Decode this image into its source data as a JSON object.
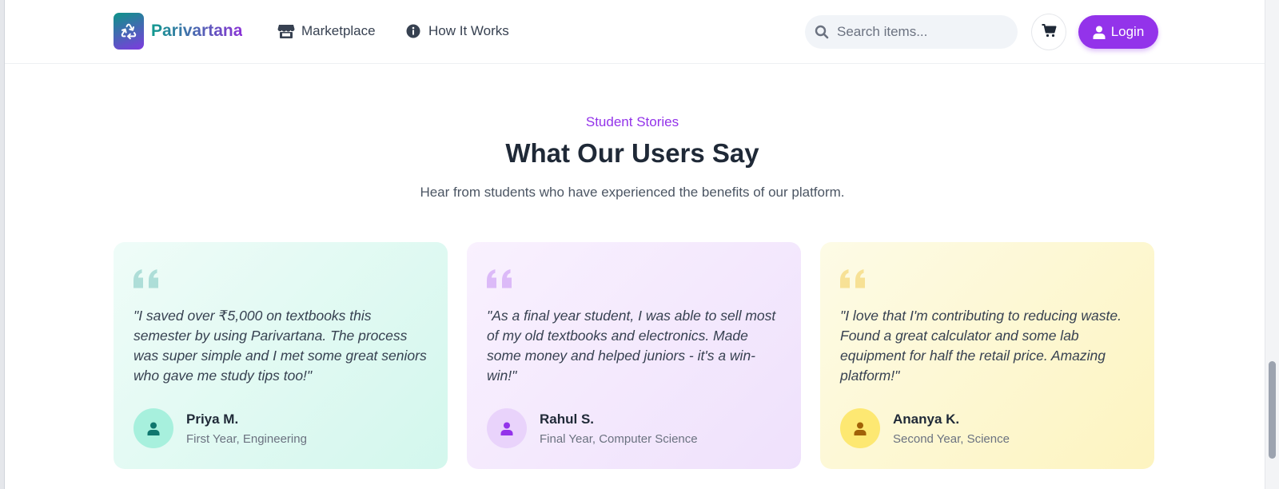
{
  "header": {
    "brand": "Parivartana",
    "nav": [
      {
        "label": "Marketplace",
        "icon": "store-icon"
      },
      {
        "label": "How It Works",
        "icon": "info-circle-icon"
      }
    ],
    "search_placeholder": "Search items...",
    "login_label": "Login"
  },
  "section": {
    "eyebrow": "Student Stories",
    "title": "What Our Users Say",
    "subtitle": "Hear from students who have experienced the benefits of our platform."
  },
  "testimonials": [
    {
      "quote": "\"I saved over ₹5,000 on textbooks this semester by using Parivartana. The process was super simple and I met some great seniors who gave me study tips too!\"",
      "name": "Priya M.",
      "role": "First Year, Engineering",
      "accent": "#0d9488"
    },
    {
      "quote": "\"As a final year student, I was able to sell most of my old textbooks and electronics. Made some money and helped juniors - it's a win-win!\"",
      "name": "Rahul S.",
      "role": "Final Year, Computer Science",
      "accent": "#9333ea"
    },
    {
      "quote": "\"I love that I'm contributing to reducing waste. Found a great calculator and some lab equipment for half the retail price. Amazing platform!\"",
      "name": "Ananya K.",
      "role": "Second Year, Science",
      "accent": "#ca8a04"
    }
  ],
  "colors": {
    "primary": "#9333ea",
    "teal": "#0d9488",
    "text": "#1f2937"
  }
}
